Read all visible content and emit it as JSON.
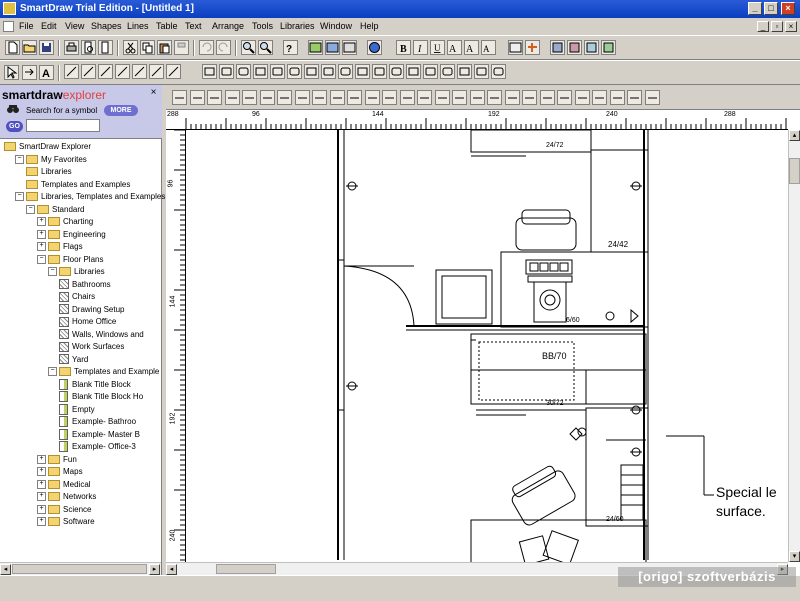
{
  "window": {
    "title": "SmartDraw Trial Edition - [Untitled 1]"
  },
  "menu": [
    "File",
    "Edit",
    "View",
    "Shapes",
    "Lines",
    "Table",
    "Text",
    "Arrange",
    "Tools",
    "Libraries",
    "Window",
    "Help"
  ],
  "explorer": {
    "logo_main": "smartdraw",
    "logo_sub": "explorer",
    "search_label": "Search for a symbol",
    "more_label": "MORE",
    "go_label": "GO",
    "search_value": "",
    "tree": [
      {
        "label": "SmartDraw Explorer",
        "indent": 0,
        "type": "folder",
        "expander": ""
      },
      {
        "label": "My Favorites",
        "indent": 1,
        "type": "folder",
        "expander": "-"
      },
      {
        "label": "Libraries",
        "indent": 2,
        "type": "folder",
        "expander": ""
      },
      {
        "label": "Templates and Examples",
        "indent": 2,
        "type": "folder",
        "expander": ""
      },
      {
        "label": "Libraries, Templates and Examples",
        "indent": 1,
        "type": "folder",
        "expander": "-"
      },
      {
        "label": "Standard",
        "indent": 2,
        "type": "folder",
        "expander": "-"
      },
      {
        "label": "Charting",
        "indent": 3,
        "type": "folder",
        "expander": "+"
      },
      {
        "label": "Engineering",
        "indent": 3,
        "type": "folder",
        "expander": "+"
      },
      {
        "label": "Flags",
        "indent": 3,
        "type": "folder",
        "expander": "+"
      },
      {
        "label": "Floor Plans",
        "indent": 3,
        "type": "folder",
        "expander": "-"
      },
      {
        "label": "Libraries",
        "indent": 4,
        "type": "folder",
        "expander": "-"
      },
      {
        "label": "Bathrooms",
        "indent": 5,
        "type": "lib",
        "expander": ""
      },
      {
        "label": "Chairs",
        "indent": 5,
        "type": "lib",
        "expander": ""
      },
      {
        "label": "Drawing Setup",
        "indent": 5,
        "type": "lib",
        "expander": ""
      },
      {
        "label": "Home Office",
        "indent": 5,
        "type": "lib",
        "expander": ""
      },
      {
        "label": "Walls, Windows and",
        "indent": 5,
        "type": "lib",
        "expander": ""
      },
      {
        "label": "Work Surfaces",
        "indent": 5,
        "type": "lib",
        "expander": ""
      },
      {
        "label": "Yard",
        "indent": 5,
        "type": "lib",
        "expander": ""
      },
      {
        "label": "Templates and Example",
        "indent": 4,
        "type": "folder",
        "expander": "-"
      },
      {
        "label": "Blank Title Block",
        "indent": 5,
        "type": "doc",
        "expander": ""
      },
      {
        "label": "Blank Title Block Ho",
        "indent": 5,
        "type": "doc",
        "expander": ""
      },
      {
        "label": "Empty",
        "indent": 5,
        "type": "doc",
        "expander": ""
      },
      {
        "label": "Example- Bathroo",
        "indent": 5,
        "type": "doc",
        "expander": ""
      },
      {
        "label": "Example- Master B",
        "indent": 5,
        "type": "doc",
        "expander": ""
      },
      {
        "label": "Example- Office-3",
        "indent": 5,
        "type": "doc",
        "expander": ""
      },
      {
        "label": "Fun",
        "indent": 3,
        "type": "folder",
        "expander": "+"
      },
      {
        "label": "Maps",
        "indent": 3,
        "type": "folder",
        "expander": "+"
      },
      {
        "label": "Medical",
        "indent": 3,
        "type": "folder",
        "expander": "+"
      },
      {
        "label": "Networks",
        "indent": 3,
        "type": "folder",
        "expander": "+"
      },
      {
        "label": "Science",
        "indent": 3,
        "type": "folder",
        "expander": "+"
      },
      {
        "label": "Software",
        "indent": 3,
        "type": "folder",
        "expander": "+"
      }
    ]
  },
  "rulers": {
    "h_labels": [
      "96",
      "144",
      "192",
      "240",
      "288"
    ],
    "v_labels": [
      "96",
      "144",
      "192",
      "240"
    ],
    "corner": "288"
  },
  "drawing": {
    "labels": [
      "24/72",
      "24/42",
      "BB/70",
      "30/72",
      "24/60",
      "6/60"
    ],
    "callout_line1": "Special le",
    "callout_line2": "surface."
  },
  "watermark": "[origo] szoftverbázis",
  "colors": {
    "titlebar": "#0a3fc0",
    "accent": "#6f6fd0"
  }
}
